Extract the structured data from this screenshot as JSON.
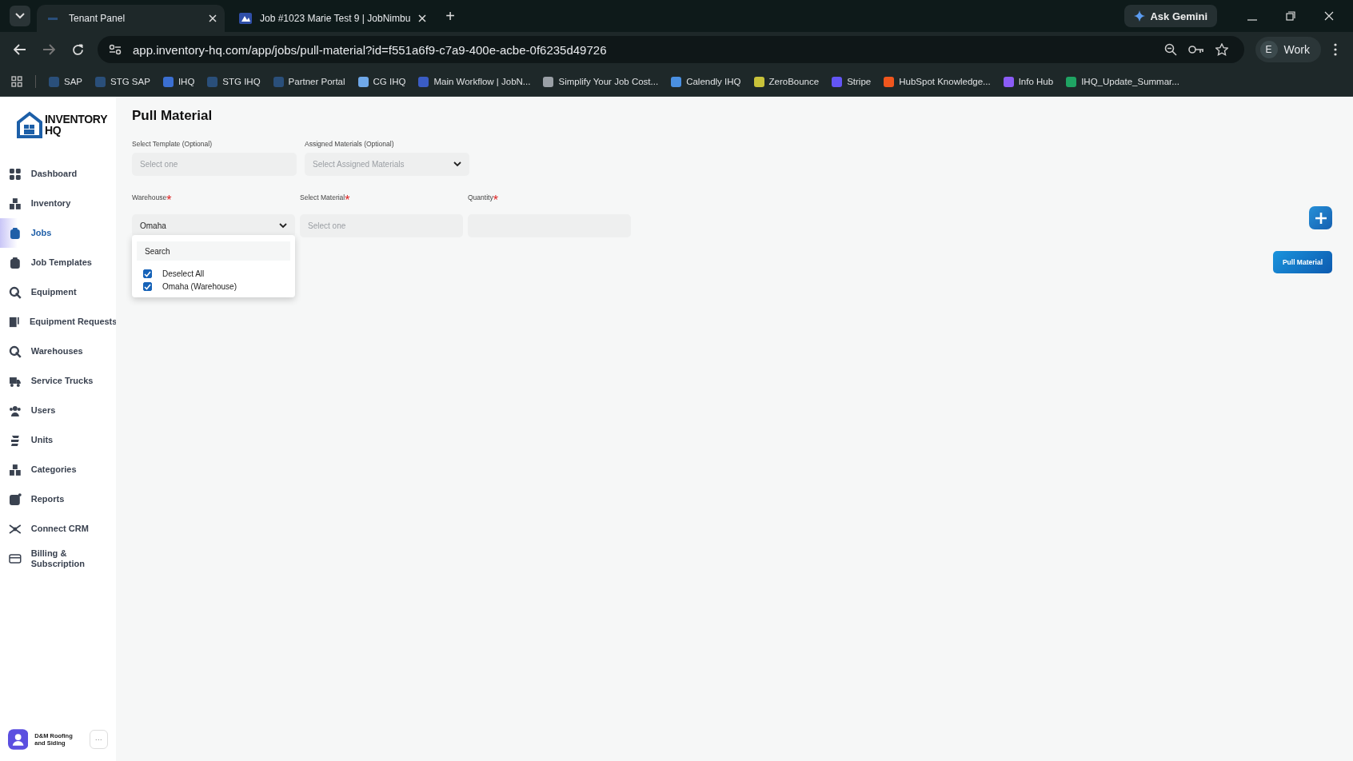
{
  "browser": {
    "tabs": [
      {
        "title": "Tenant Panel",
        "selected": true
      },
      {
        "title": "Job #1023 Marie Test 9 | JobNimbu",
        "selected": false
      }
    ],
    "new_tab": "+",
    "ask_button": "Ask Gemini",
    "url": "app.inventory-hq.com/app/jobs/pull-material?id=f551a6f9-c7a9-400e-acbe-0f6235d49726",
    "profile": {
      "initial": "E",
      "name": "Work"
    },
    "bookmarks": [
      {
        "label": "SAP",
        "color": "#2a4f7a"
      },
      {
        "label": "STG SAP",
        "color": "#2a4f7a"
      },
      {
        "label": "IHQ",
        "color": "#3b6fd1"
      },
      {
        "label": "STG IHQ",
        "color": "#2a4f7a"
      },
      {
        "label": "Partner Portal",
        "color": "#2a4f7a"
      },
      {
        "label": "CG IHQ",
        "color": "#6fa8e8"
      },
      {
        "label": "Main Workflow | JobN...",
        "color": "#3a5cc4"
      },
      {
        "label": "Simplify Your Job Cost...",
        "color": "#9aa0a6"
      },
      {
        "label": "Calendly IHQ",
        "color": "#4a90e2"
      },
      {
        "label": "ZeroBounce",
        "color": "#c8c23a"
      },
      {
        "label": "Stripe",
        "color": "#6355f5"
      },
      {
        "label": "HubSpot Knowledge...",
        "color": "#f0561d"
      },
      {
        "label": "Info Hub",
        "color": "#8b5cf6"
      },
      {
        "label": "IHQ_Update_Summar...",
        "color": "#1fa463"
      }
    ]
  },
  "logo": {
    "line_1": "INVENTORY",
    "line_2": "HQ"
  },
  "sidebar": {
    "items": [
      {
        "label": "Dashboard",
        "kind": "grid",
        "selected": false
      },
      {
        "label": "Inventory",
        "kind": "boxes",
        "selected": false
      },
      {
        "label": "Jobs",
        "kind": "case",
        "selected": true
      },
      {
        "label": "Job Templates",
        "kind": "case",
        "selected": false
      },
      {
        "label": "Equipment",
        "kind": "gear",
        "selected": false
      },
      {
        "label": "Equipment Requests",
        "kind": "list",
        "selected": false
      },
      {
        "label": "Warehouses",
        "kind": "gear",
        "selected": false
      },
      {
        "label": "Service Trucks",
        "kind": "truck",
        "selected": false
      },
      {
        "label": "Users",
        "kind": "users",
        "selected": false
      },
      {
        "label": "Units",
        "kind": "units",
        "selected": false
      },
      {
        "label": "Categories",
        "kind": "boxes",
        "selected": false
      },
      {
        "label": "Reports",
        "kind": "chart",
        "selected": false
      },
      {
        "label": "Connect CRM",
        "kind": "crm",
        "selected": false
      },
      {
        "label": "Billing & Subscription",
        "kind": "card",
        "selected": false
      }
    ],
    "account": {
      "name": "D&M Roofing and Siding",
      "more": "···"
    }
  },
  "page": {
    "title": "Pull Material",
    "required_mark": "*",
    "row_1": [
      {
        "label": "Select Template (Optional)",
        "required": false,
        "placeholder": "Select one",
        "dropdown": false
      },
      {
        "label": "Assigned Materials (Optional)",
        "required": false,
        "placeholder": "Select Assigned Materials",
        "dropdown": true
      }
    ],
    "row_2": [
      {
        "label": "Warehouse",
        "required": true,
        "value": "Omaha",
        "dropdown": true
      },
      {
        "label": "Select Material",
        "required": true,
        "placeholder": "Select one",
        "dropdown": false
      },
      {
        "label": "Quantity",
        "required": true,
        "dropdown": false
      }
    ],
    "warehouse_menu": {
      "search_placeholder": "Search",
      "options": [
        {
          "label": "Deselect All",
          "checked": true
        },
        {
          "label": "Omaha (Warehouse)",
          "checked": true
        }
      ]
    },
    "submit_button": "Pull Material"
  }
}
